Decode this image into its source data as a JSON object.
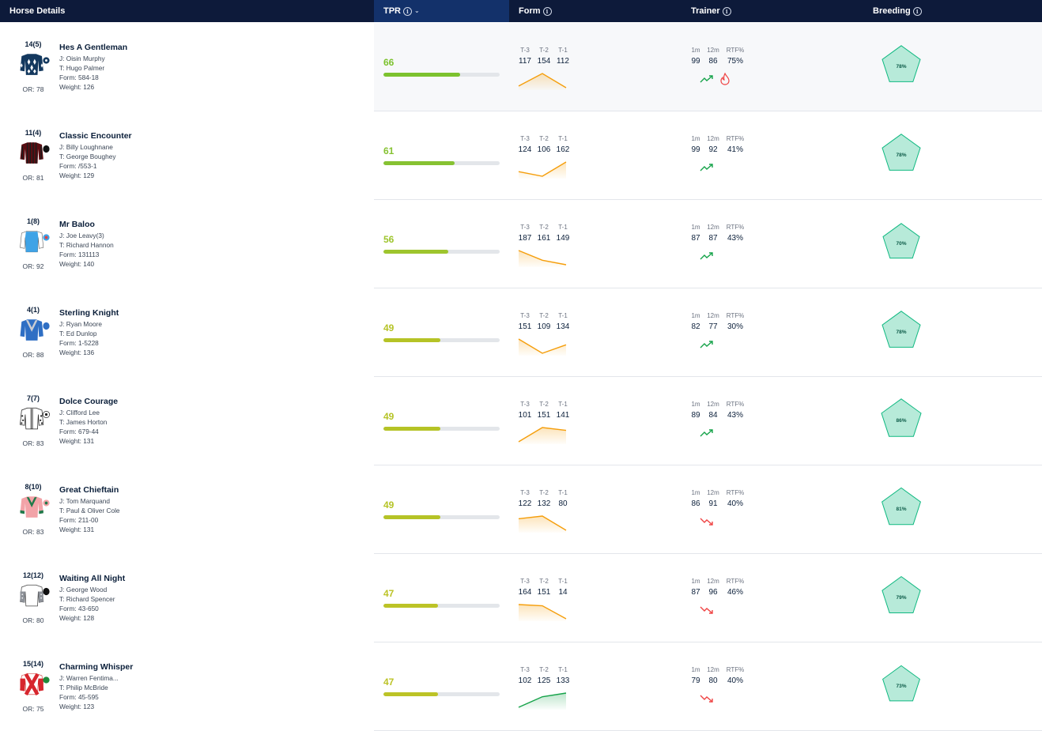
{
  "header": {
    "horse_details": "Horse Details",
    "tpr": "TPR",
    "form": "Form",
    "trainer": "Trainer",
    "breeding": "Breeding"
  },
  "form_labels": [
    "T-3",
    "T-2",
    "T-1"
  ],
  "trainer_labels": [
    "1m",
    "12m",
    "RTF%"
  ],
  "colors": {
    "header_bg": "#0d1a3a",
    "tpr_header_bg": "#13316a",
    "trend_up": "#16a34a",
    "trend_down": "#ef4444",
    "form_line_orange": "#f59e0b",
    "form_line_green": "#16a34a",
    "breeding_fill": "#b7ead9",
    "breeding_stroke": "#10b981"
  },
  "runners": [
    {
      "pos": "14(5)",
      "name": "Hes A Gentleman",
      "jockey": "J: Oisin Murphy",
      "trainer": "T: Hugo Palmer",
      "form": "Form: 584-18",
      "weight": "Weight: 126",
      "or": "OR: 78",
      "tpr": "66",
      "tpr_pct": 66,
      "tpr_color": "#7cc22e",
      "form_vals": [
        "117",
        "154",
        "112"
      ],
      "form_line": "orange",
      "t1m": "99",
      "t12m": "86",
      "rtf": "75%",
      "trend": "up",
      "hot": true,
      "breeding": "78%",
      "silk": "navy-diamonds"
    },
    {
      "pos": "11(4)",
      "name": "Classic Encounter",
      "jockey": "J: Billy Loughnane",
      "trainer": "T: George Boughey",
      "form": "Form: /553-1",
      "weight": "Weight: 129",
      "or": "OR: 81",
      "tpr": "61",
      "tpr_pct": 61,
      "tpr_color": "#86c232",
      "form_vals": [
        "124",
        "106",
        "162"
      ],
      "form_line": "orange",
      "t1m": "99",
      "t12m": "92",
      "rtf": "41%",
      "trend": "up",
      "hot": false,
      "breeding": "78%",
      "silk": "maroon-stripes"
    },
    {
      "pos": "1(8)",
      "name": "Mr Baloo",
      "jockey": "J: Joe Leavy(3)",
      "trainer": "T: Richard Hannon",
      "form": "Form: 131113",
      "weight": "Weight: 140",
      "or": "OR: 92",
      "tpr": "56",
      "tpr_pct": 56,
      "tpr_color": "#9ec52e",
      "form_vals": [
        "187",
        "161",
        "149"
      ],
      "form_line": "orange",
      "t1m": "87",
      "t12m": "87",
      "rtf": "43%",
      "trend": "up",
      "hot": false,
      "breeding": "70%",
      "silk": "light-blue"
    },
    {
      "pos": "4(1)",
      "name": "Sterling Knight",
      "jockey": "J: Ryan Moore",
      "trainer": "T: Ed Dunlop",
      "form": "Form: 1-5228",
      "weight": "Weight: 136",
      "or": "OR: 88",
      "tpr": "49",
      "tpr_pct": 49,
      "tpr_color": "#b5c326",
      "form_vals": [
        "151",
        "109",
        "134"
      ],
      "form_line": "orange",
      "t1m": "82",
      "t12m": "77",
      "rtf": "30%",
      "trend": "up",
      "hot": false,
      "breeding": "78%",
      "silk": "blue-chevron"
    },
    {
      "pos": "7(7)",
      "name": "Dolce Courage",
      "jockey": "J: Clifford Lee",
      "trainer": "T: James Horton",
      "form": "Form: 679-44",
      "weight": "Weight: 131",
      "or": "OR: 83",
      "tpr": "49",
      "tpr_pct": 49,
      "tpr_color": "#b5c326",
      "form_vals": [
        "101",
        "151",
        "141"
      ],
      "form_line": "orange",
      "t1m": "89",
      "t12m": "84",
      "rtf": "43%",
      "trend": "up",
      "hot": false,
      "breeding": "86%",
      "silk": "white-spots"
    },
    {
      "pos": "8(10)",
      "name": "Great Chieftain",
      "jockey": "J: Tom Marquand",
      "trainer": "T: Paul & Oliver Cole",
      "form": "Form: 211-00",
      "weight": "Weight: 131",
      "or": "OR: 83",
      "tpr": "49",
      "tpr_pct": 49,
      "tpr_color": "#b5c326",
      "form_vals": [
        "122",
        "132",
        "80"
      ],
      "form_line": "orange",
      "t1m": "86",
      "t12m": "91",
      "rtf": "40%",
      "trend": "down",
      "hot": false,
      "breeding": "81%",
      "silk": "pink-green"
    },
    {
      "pos": "12(12)",
      "name": "Waiting All Night",
      "jockey": "J: George Wood",
      "trainer": "T: Richard Spencer",
      "form": "Form: 43-650",
      "weight": "Weight: 128",
      "or": "OR: 80",
      "tpr": "47",
      "tpr_pct": 47,
      "tpr_color": "#bcc327",
      "form_vals": [
        "164",
        "151",
        "14"
      ],
      "form_line": "orange",
      "t1m": "87",
      "t12m": "96",
      "rtf": "46%",
      "trend": "down",
      "hot": false,
      "breeding": "79%",
      "silk": "white-grey"
    },
    {
      "pos": "15(14)",
      "name": "Charming Whisper",
      "jockey": "J: Warren Fentima...",
      "trainer": "T: Philip McBride",
      "form": "Form: 45-595",
      "weight": "Weight: 123",
      "or": "OR: 75",
      "tpr": "47",
      "tpr_pct": 47,
      "tpr_color": "#bcc327",
      "form_vals": [
        "102",
        "125",
        "133"
      ],
      "form_line": "green",
      "t1m": "79",
      "t12m": "80",
      "rtf": "40%",
      "trend": "down",
      "hot": false,
      "breeding": "73%",
      "silk": "red-cross"
    }
  ]
}
